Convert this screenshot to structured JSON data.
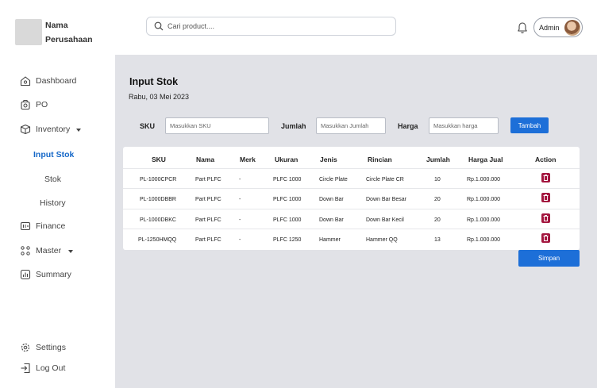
{
  "company": {
    "line1": "Nama",
    "line2": "Perusahaan"
  },
  "search": {
    "placeholder": "Cari product...."
  },
  "user": {
    "label": "Admin"
  },
  "sidebar": {
    "dashboard": "Dashboard",
    "po": "PO",
    "inventory": "Inventory",
    "inventory_sub": [
      "Input Stok",
      "Stok",
      "History"
    ],
    "finance": "Finance",
    "master": "Master",
    "summary": "Summary",
    "settings": "Settings",
    "logout": "Log Out"
  },
  "page": {
    "title": "Input Stok",
    "date": "Rabu, 03 Mei 2023"
  },
  "form": {
    "sku_label": "SKU",
    "sku_placeholder": "Masukkan SKU",
    "jumlah_label": "Jumlah",
    "jumlah_placeholder": "Masukkan Jumlah",
    "harga_label": "Harga",
    "harga_placeholder": "Masukkan harga",
    "add_button": "Tambah"
  },
  "table": {
    "headers": [
      "SKU",
      "Nama",
      "Merk",
      "Ukuran",
      "Jenis",
      "Rincian",
      "Jumlah",
      "Harga Jual",
      "Action"
    ],
    "rows": [
      [
        "PL-1000CPCR",
        "Part PLFC",
        "-",
        "PLFC 1000",
        "Circle Plate",
        "Circle Plate CR",
        "10",
        "Rp.1.000.000"
      ],
      [
        "PL-1000DBBR",
        "Part PLFC",
        "-",
        "PLFC 1000",
        "Down Bar",
        "Down Bar Besar",
        "20",
        "Rp.1.000.000"
      ],
      [
        "PL-1000DBKC",
        "Part PLFC",
        "-",
        "PLFC 1000",
        "Down Bar",
        "Down Bar Kecil",
        "20",
        "Rp.1.000.000"
      ],
      [
        "PL-1250HMQQ",
        "Part PLFC",
        "-",
        "PLFC 1250",
        "Hammer",
        "Hammer QQ",
        "13",
        "Rp.1.000.000"
      ]
    ]
  },
  "save_button": "Simpan",
  "colors": {
    "accent": "#1d6fd8",
    "active_nav": "#1668c8",
    "delete": "#a3163f",
    "main_bg": "#e1e2e7"
  },
  "icons": [
    "search-icon",
    "bell-icon",
    "home-icon",
    "box-icon",
    "cube-icon",
    "wallet-icon",
    "grid-icon",
    "chart-icon",
    "gear-icon",
    "logout-icon",
    "trash-icon"
  ]
}
